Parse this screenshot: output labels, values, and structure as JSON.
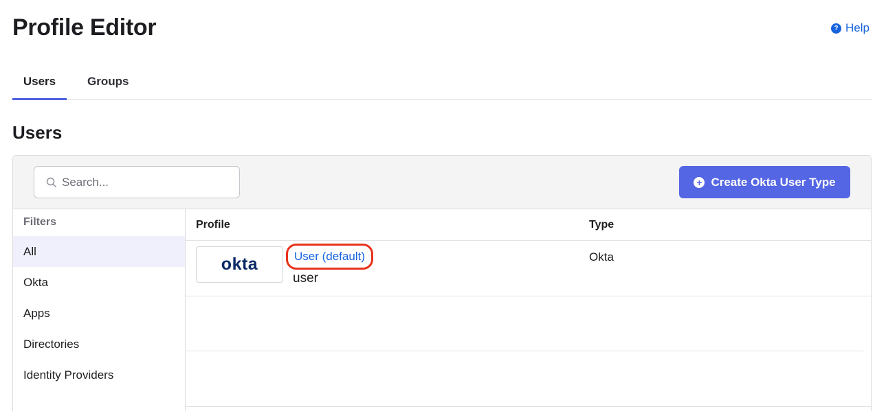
{
  "header": {
    "title": "Profile Editor",
    "help_label": "Help"
  },
  "tabs": [
    {
      "label": "Users",
      "active": true
    },
    {
      "label": "Groups",
      "active": false
    }
  ],
  "section": {
    "title": "Users"
  },
  "search": {
    "placeholder": "Search...",
    "value": ""
  },
  "toolbar": {
    "create_label": "Create Okta User Type"
  },
  "filters": {
    "title": "Filters",
    "items": [
      {
        "label": "All",
        "active": true
      },
      {
        "label": "Okta"
      },
      {
        "label": "Apps"
      },
      {
        "label": "Directories"
      },
      {
        "label": "Identity Providers"
      }
    ]
  },
  "table": {
    "columns": [
      "Profile",
      "Type"
    ],
    "rows": [
      {
        "logo_text": "okta",
        "profile_link": "User (default)",
        "profile_sub": "user",
        "type": "Okta"
      }
    ]
  },
  "colors": {
    "accent": "#5466e3",
    "link": "#1662dd",
    "highlight_ring": "#e8321b",
    "logo": "#0b2a66"
  }
}
